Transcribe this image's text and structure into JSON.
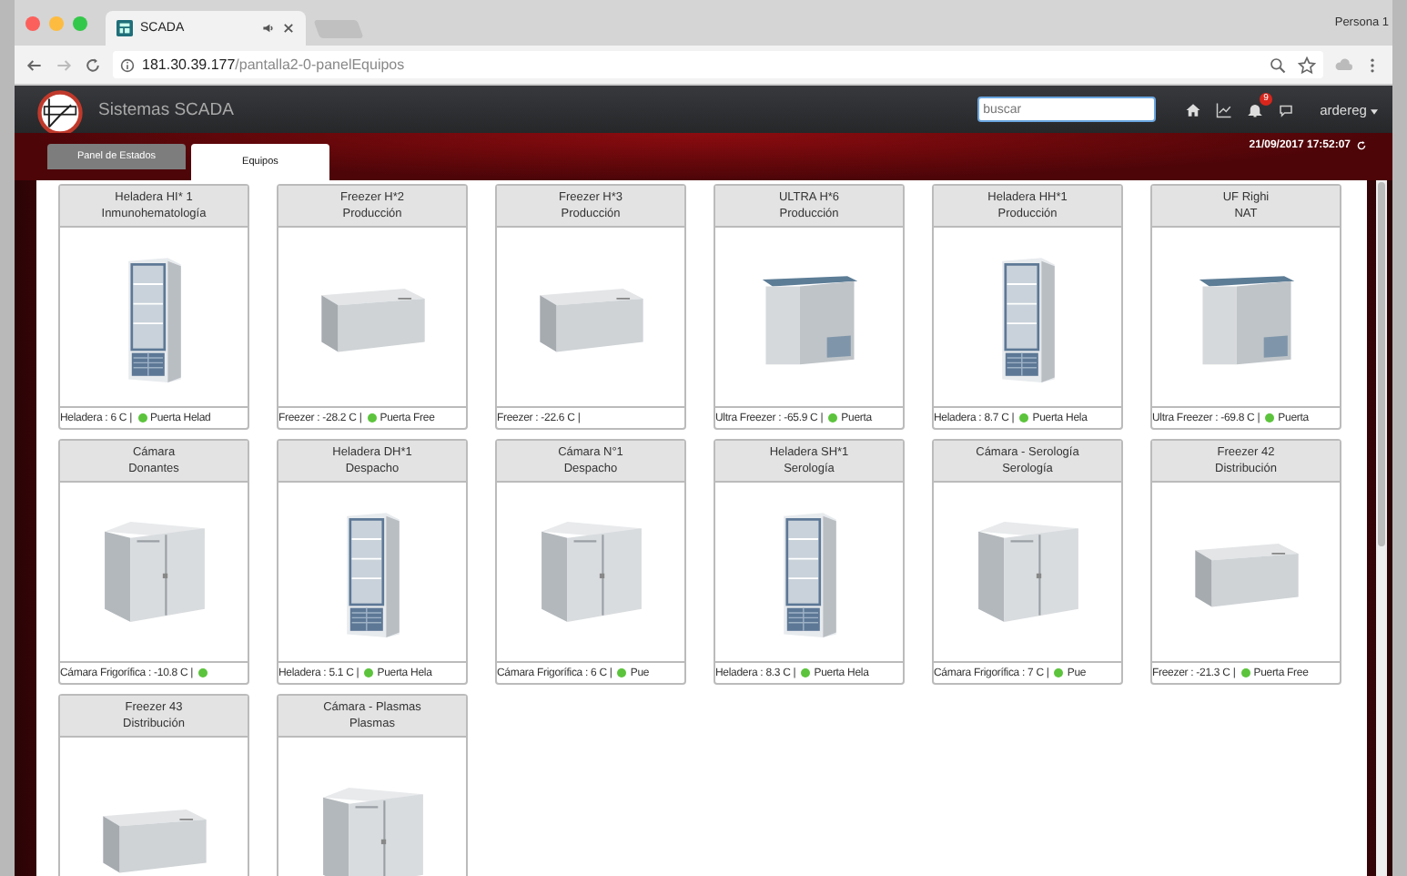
{
  "browser": {
    "tab_title": "SCADA",
    "profile": "Persona 1",
    "url_host": "181.30.39.177",
    "url_path": "/pantalla2-0-panelEquipos"
  },
  "navbar": {
    "title": "Sistemas SCADA",
    "search": {
      "placeholder": "buscar"
    },
    "alerts_badge": "9",
    "user": "ardereg"
  },
  "timestamp": "21/09/2017 17:52:07",
  "tabs": [
    {
      "label": "Panel de Estados",
      "selected": false
    },
    {
      "label": "Equipos",
      "selected": true
    }
  ],
  "equipment": [
    {
      "name": "Heladera HI* 1",
      "area": "Inmunohematología",
      "kind": "fridge",
      "status": "Heladera : 6 C |",
      "door_sensor": true,
      "door_label": "Puerta Helad"
    },
    {
      "name": "Freezer H*2",
      "area": "Producción",
      "kind": "chest",
      "status": "Freezer : -28.2 C |",
      "door_sensor": true,
      "door_label": "Puerta Free"
    },
    {
      "name": "Freezer H*3",
      "area": "Producción",
      "kind": "chest",
      "status": "Freezer : -22.6 C |",
      "door_sensor": false
    },
    {
      "name": "ULTRA H*6",
      "area": "Producción",
      "kind": "ultra",
      "status": "Ultra Freezer : -65.9 C |",
      "door_sensor": true,
      "door_label": "Puerta"
    },
    {
      "name": "Heladera HH*1",
      "area": "Producción",
      "kind": "fridge",
      "status": "Heladera : 8.7 C |",
      "door_sensor": true,
      "door_label": "Puerta Hela"
    },
    {
      "name": "UF Righi",
      "area": "NAT",
      "kind": "ultra",
      "status": "Ultra Freezer : -69.8 C |",
      "door_sensor": true,
      "door_label": "Puerta"
    },
    {
      "name": "Cámara",
      "area": "Donantes",
      "kind": "room",
      "status": "Cámara Frigorífica : -10.8 C |",
      "door_sensor": true
    },
    {
      "name": "Heladera DH*1",
      "area": "Despacho",
      "kind": "fridge",
      "status": "Heladera : 5.1 C |",
      "door_sensor": true,
      "door_label": "Puerta Hela"
    },
    {
      "name": "Cámara N°1",
      "area": "Despacho",
      "kind": "room",
      "status": "Cámara Frigorífica : 6 C |",
      "door_sensor": true,
      "door_label": "Pue"
    },
    {
      "name": "Heladera SH*1",
      "area": "Serología",
      "kind": "fridge",
      "status": "Heladera : 8.3 C |",
      "door_sensor": true,
      "door_label": "Puerta Hela"
    },
    {
      "name": "Cámara - Serología",
      "area": "Serología",
      "kind": "room",
      "status": "Cámara Frigorífica : 7 C |",
      "door_sensor": true,
      "door_label": "Pue"
    },
    {
      "name": "Freezer 42",
      "area": "Distribución",
      "kind": "chest",
      "status": "Freezer : -21.3 C |",
      "door_sensor": true,
      "door_label": "Puerta Free"
    },
    {
      "name": "Freezer 43",
      "area": "Distribución",
      "kind": "chest"
    },
    {
      "name": "Cámara - Plasmas",
      "area": "Plasmas",
      "kind": "room"
    }
  ]
}
